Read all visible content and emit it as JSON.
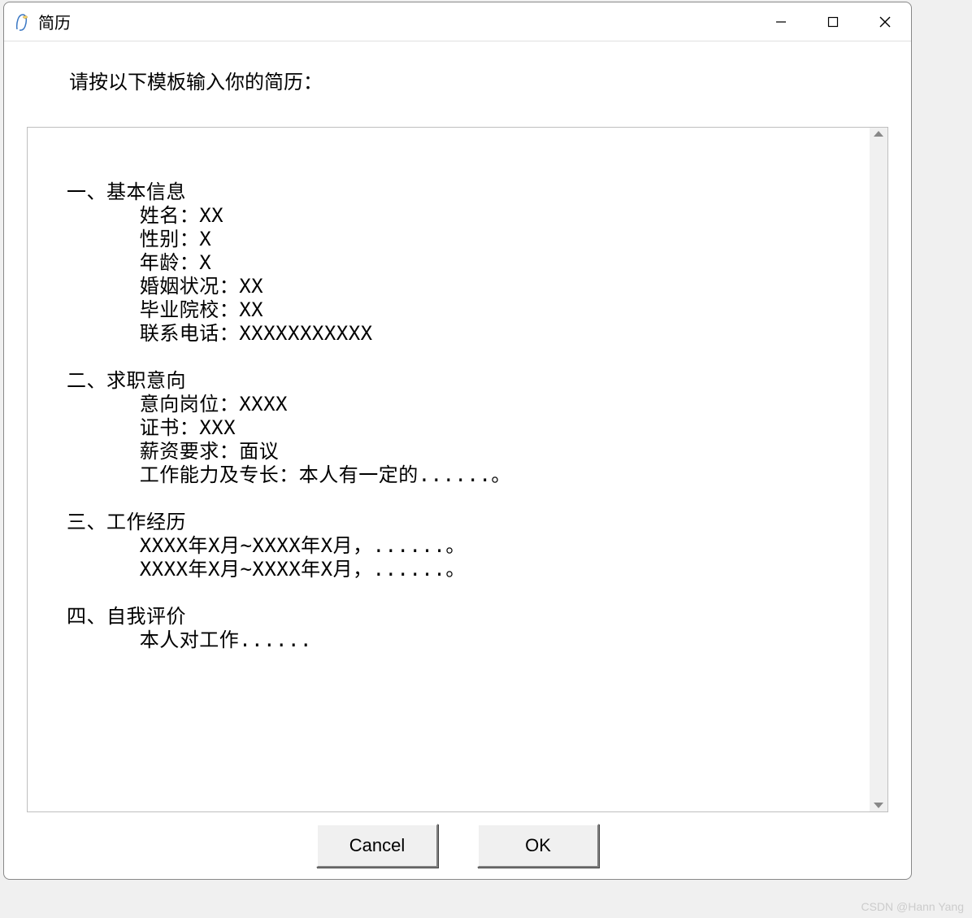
{
  "window": {
    "title": "简历"
  },
  "prompt": "请按以下模板输入你的简历：",
  "textarea": {
    "value": "\n一、基本信息\n      姓名：XX\n      性别：X\n      年龄：X\n      婚姻状况：XX\n      毕业院校：XX\n      联系电话：XXXXXXXXXXX\n\n二、求职意向\n      意向岗位：XXXX\n      证书：XXX\n      薪资要求：面议\n      工作能力及专长：本人有一定的......。\n\n三、工作经历\n      XXXX年X月~XXXX年X月，......。\n      XXXX年X月~XXXX年X月，......。\n\n四、自我评价\n      本人对工作......"
  },
  "buttons": {
    "cancel": "Cancel",
    "ok": "OK"
  },
  "watermark": "CSDN @Hann Yang"
}
